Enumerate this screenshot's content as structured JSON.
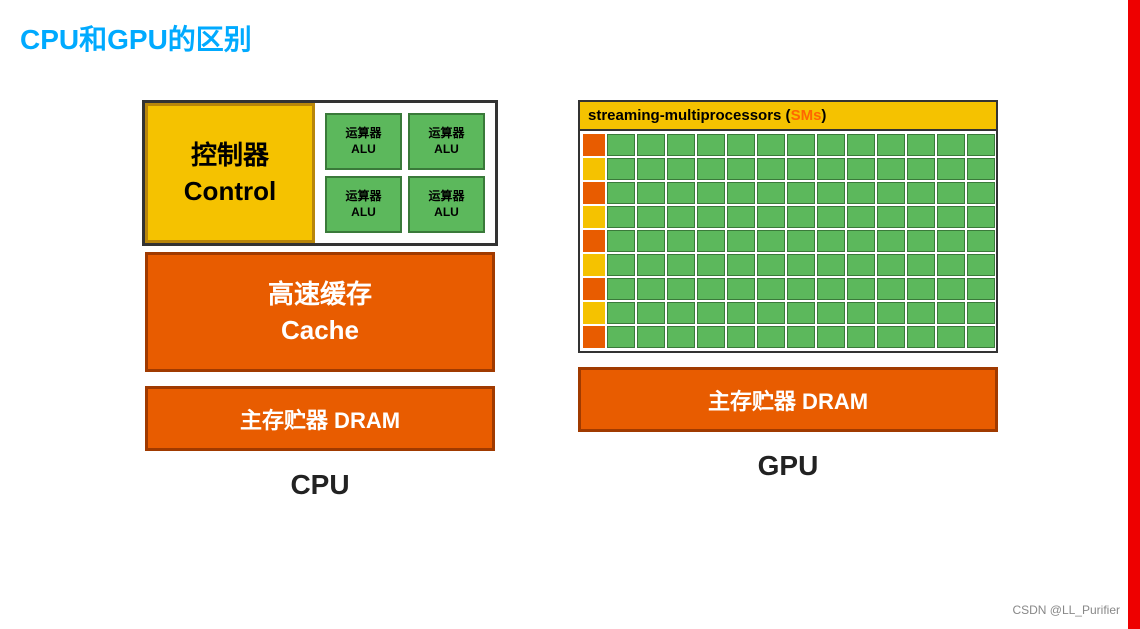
{
  "title": "CPU和GPU的区别",
  "red_bar": true,
  "cpu": {
    "control_cn": "控制器",
    "control_en": "Control",
    "alus": [
      {
        "cn": "运算器",
        "en": "ALU"
      },
      {
        "cn": "运算器",
        "en": "ALU"
      },
      {
        "cn": "运算器",
        "en": "ALU"
      },
      {
        "cn": "运算器",
        "en": "ALU"
      }
    ],
    "cache_cn": "高速缓存",
    "cache_en": "Cache",
    "dram": "主存贮器 DRAM",
    "label": "CPU"
  },
  "gpu": {
    "sm_header_text": "streaming-multiprocessors (",
    "sm_sms": "SMs",
    "sm_header_close": ")",
    "rows": [
      {
        "indicator": "orange",
        "cells": 13
      },
      {
        "indicator": "yellow",
        "cells": 13
      },
      {
        "indicator": "orange",
        "cells": 13
      },
      {
        "indicator": "yellow",
        "cells": 13
      },
      {
        "indicator": "orange",
        "cells": 13
      },
      {
        "indicator": "yellow",
        "cells": 13
      },
      {
        "indicator": "orange",
        "cells": 13
      },
      {
        "indicator": "yellow",
        "cells": 13
      },
      {
        "indicator": "orange",
        "cells": 13
      }
    ],
    "dram": "主存贮器 DRAM",
    "label": "GPU"
  },
  "watermark": "CSDN @LL_Purifier"
}
